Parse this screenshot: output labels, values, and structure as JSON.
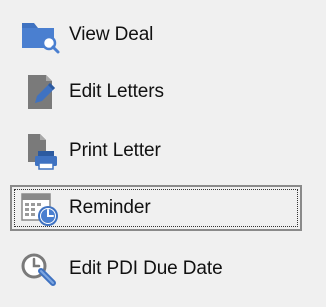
{
  "menu": {
    "items": [
      {
        "label": "View Deal",
        "icon": "folder-search-icon"
      },
      {
        "label": "Edit Letters",
        "icon": "document-edit-icon"
      },
      {
        "label": "Print Letter",
        "icon": "document-print-icon"
      },
      {
        "label": "Reminder",
        "icon": "calendar-clock-icon",
        "selected": true
      },
      {
        "label": "Edit PDI Due Date",
        "icon": "clock-edit-icon"
      }
    ]
  },
  "colors": {
    "icon_blue": "#3f72c1",
    "icon_gray": "#6e6e6e",
    "selection_border": "#8a8a8a"
  }
}
